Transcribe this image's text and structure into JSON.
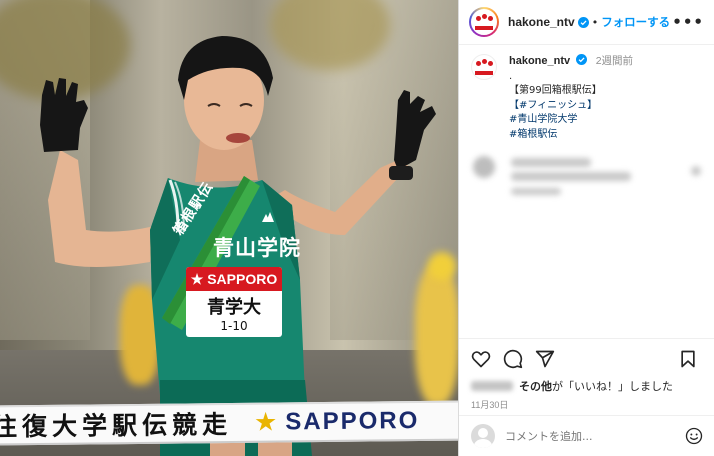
{
  "photo": {
    "tape_text": "往復大学駅伝競走",
    "tape_star": "★",
    "tape_brand": "SAPPORO",
    "chest_text": "青山学院",
    "sash_text": "箱根駅伝",
    "bib_sponsor": "★ SAPPORO",
    "bib_name": "青学大",
    "bib_number": "1-10"
  },
  "header": {
    "username": "hakone_ntv",
    "separator": "•",
    "follow_label": "フォローする",
    "more_icon": "more-horizontal-icon"
  },
  "post": {
    "username": "hakone_ntv",
    "time_ago": "2週間前",
    "caption_dot": ".",
    "caption_lines": [
      "【第99回箱根駅伝】"
    ],
    "tag_lines": [
      "【#フィニッシュ】",
      "#青山学院大学",
      "#箱根駅伝"
    ]
  },
  "actions": {
    "icons": [
      "heart-icon",
      "comment-icon",
      "share-icon",
      "bookmark-icon"
    ],
    "likes_text": "その他",
    "likes_suffix": "が「いいね！」しました",
    "date": "11月30日"
  },
  "comment": {
    "placeholder": "コメントを追加...",
    "emoji_icon": "smiley-icon"
  },
  "colors": {
    "accent": "#0095f6",
    "tag": "#00376b",
    "jersey": "#16876f",
    "sponsor_red": "#d71920"
  }
}
